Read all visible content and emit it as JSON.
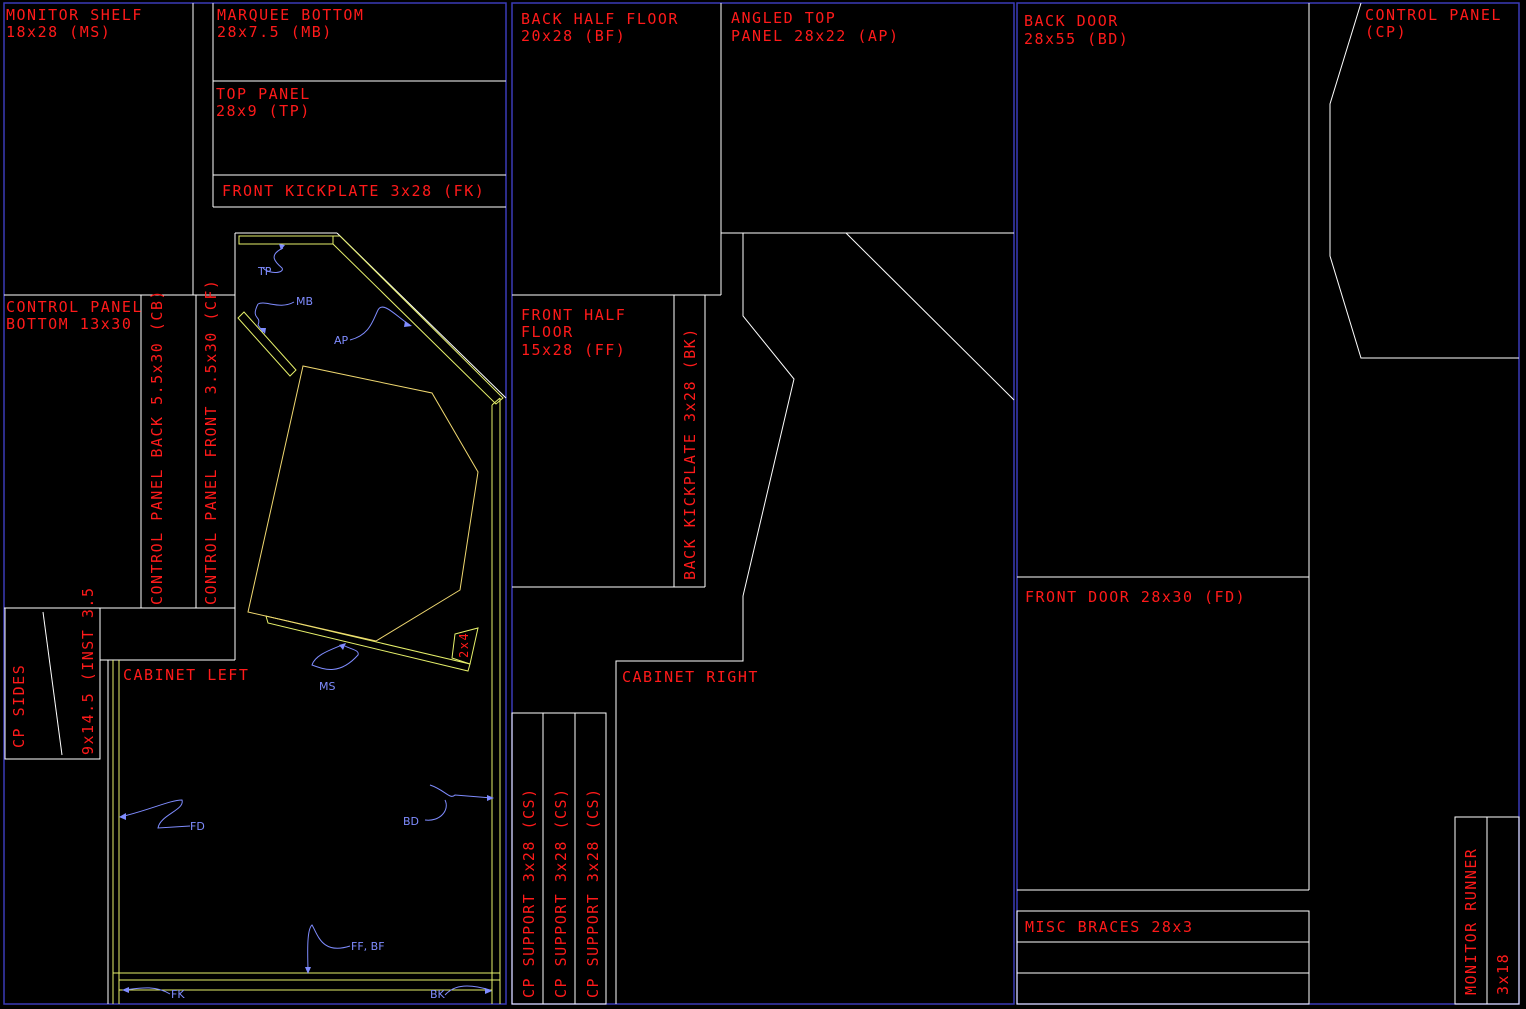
{
  "labels": {
    "monitor_shelf": [
      "MONITOR SHELF",
      "18x28 (MS)"
    ],
    "marquee_bottom": [
      "MARQUEE BOTTOM",
      "28x7.5 (MB)"
    ],
    "top_panel": [
      "TOP PANEL",
      "28x9 (TP)"
    ],
    "front_kickplate": "FRONT KICKPLATE 3x28 (FK)",
    "control_panel_bottom": [
      "CONTROL PANEL",
      "BOTTOM 13x30"
    ],
    "control_panel_back": "CONTROL PANEL BACK 5.5x30 (CB)",
    "control_panel_front": "CONTROL PANEL FRONT 3.5x30 (CF)",
    "cp_sides": "CP SIDES",
    "cp_sides_size": "9x14.5 (INST 3.5",
    "cabinet_left": "CABINET LEFT",
    "back_half_floor": [
      "BACK HALF FLOOR",
      "20x28 (BF)"
    ],
    "angled_top": [
      "ANGLED TOP",
      "PANEL 28x22 (AP)"
    ],
    "front_half_floor": [
      "FRONT HALF",
      "FLOOR",
      "15x28 (FF)"
    ],
    "back_kickplate": "BACK KICKPLATE 3x28 (BK)",
    "cabinet_right": "CABINET RIGHT",
    "cp_support_1": "CP SUPPORT 3x28 (CS)",
    "cp_support_2": "CP SUPPORT 3x28 (CS)",
    "cp_support_3": "CP SUPPORT 3x28 (CS)",
    "back_door": [
      "BACK DOOR",
      "28x55 (BD)"
    ],
    "control_panel": [
      "CONTROL PANEL",
      "(CP)"
    ],
    "front_door": "FRONT DOOR 28x30 (FD)",
    "misc_braces": "MISC BRACES 28x3",
    "monitor_runner": "MONITOR RUNNER",
    "monitor_runner_size": "3x18"
  },
  "callouts": {
    "tp": "TP",
    "mb": "MB",
    "ap": "AP",
    "ms": "MS",
    "two_by_four": "2x4",
    "fd": "FD",
    "bd": "BD",
    "ff_bf": "FF, BF",
    "fk": "FK",
    "bk": "BK"
  },
  "colors": {
    "background": "#000000",
    "sheet_outline": "#3a3ab8",
    "cut_line": "#ffffff",
    "part_label": "#ff1a1a",
    "assembly_line": "#e6f06a",
    "callout": "#7f8cff"
  }
}
